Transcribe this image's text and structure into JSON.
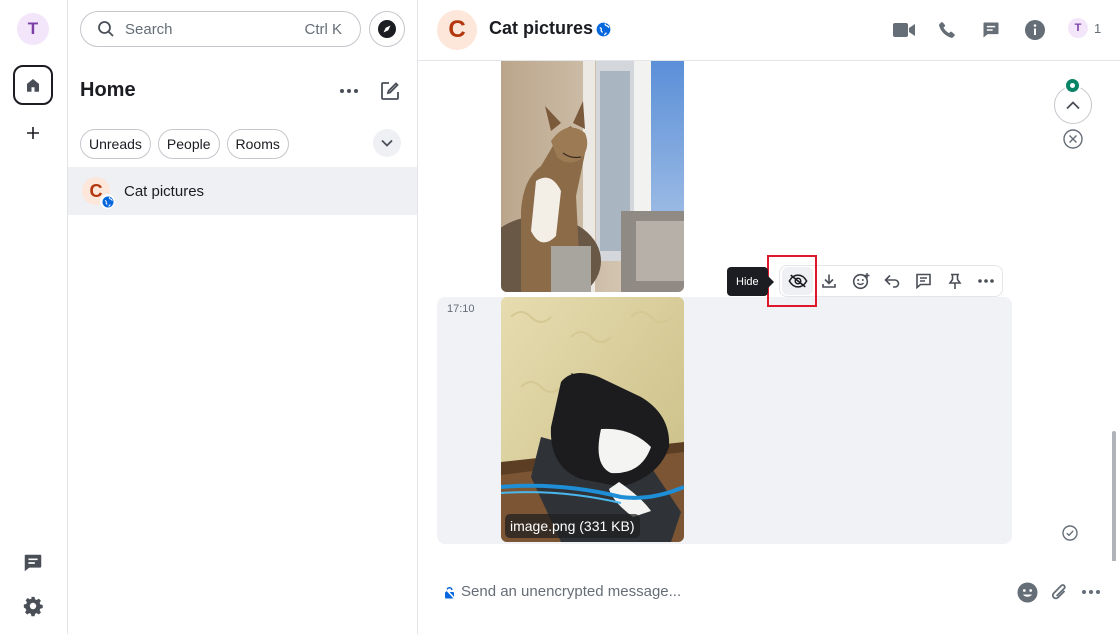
{
  "rail": {
    "user_initial": "T"
  },
  "roomlist": {
    "search": {
      "label": "Search",
      "shortcut": "Ctrl K"
    },
    "title": "Home",
    "filters": [
      "Unreads",
      "People",
      "Rooms"
    ],
    "rooms": [
      {
        "initial": "C",
        "name": "Cat pictures"
      }
    ]
  },
  "room": {
    "initial": "C",
    "name": "Cat pictures",
    "member_initial": "T",
    "member_count": "1"
  },
  "timeline": {
    "event": {
      "timestamp": "17:10",
      "caption": "image.png (331 KB)"
    },
    "tooltip": "Hide"
  },
  "composer": {
    "placeholder": "Send an unencrypted message..."
  },
  "colors": {
    "accent": "#0a8466",
    "highlight": "#e0162b",
    "room_avatar_bg": "#fde6da",
    "room_avatar_fg": "#b3370d",
    "user_avatar_bg": "#f3e6fb",
    "user_avatar_fg": "#7c3fa7"
  },
  "icons": {
    "rail": [
      "home-icon",
      "plus-icon",
      "threads-icon",
      "settings-icon"
    ],
    "header": [
      "video-call-icon",
      "voice-call-icon",
      "threads-icon",
      "room-info-icon"
    ],
    "actionbar": [
      "hide-icon",
      "download-icon",
      "react-icon",
      "reply-icon",
      "thread-icon",
      "pin-icon",
      "options-icon"
    ],
    "composer": [
      "emoji-icon",
      "attachment-icon",
      "more-options-icon"
    ]
  }
}
